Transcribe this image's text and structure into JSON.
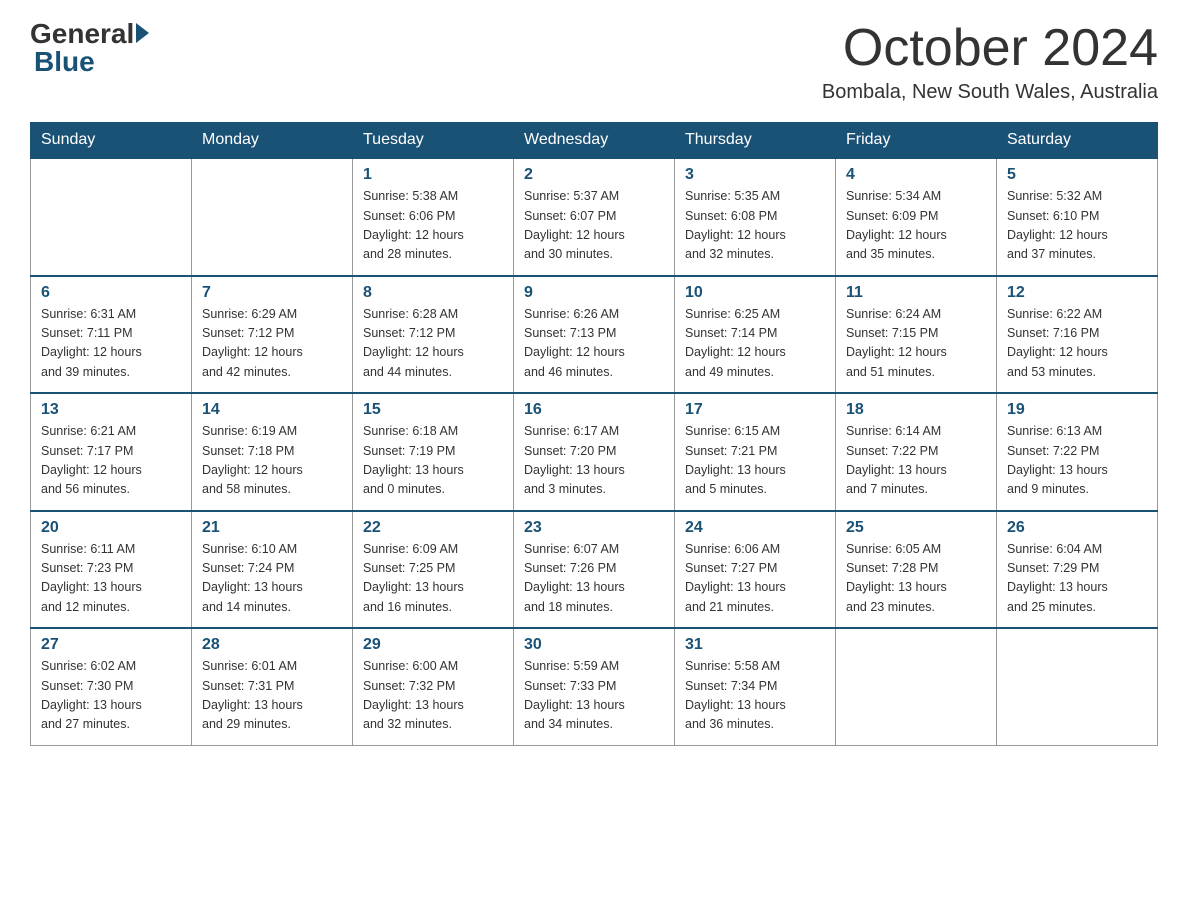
{
  "header": {
    "logo_general": "General",
    "logo_blue": "Blue",
    "month_title": "October 2024",
    "location": "Bombala, New South Wales, Australia"
  },
  "weekdays": [
    "Sunday",
    "Monday",
    "Tuesday",
    "Wednesday",
    "Thursday",
    "Friday",
    "Saturday"
  ],
  "weeks": [
    [
      {
        "day": "",
        "info": ""
      },
      {
        "day": "",
        "info": ""
      },
      {
        "day": "1",
        "info": "Sunrise: 5:38 AM\nSunset: 6:06 PM\nDaylight: 12 hours\nand 28 minutes."
      },
      {
        "day": "2",
        "info": "Sunrise: 5:37 AM\nSunset: 6:07 PM\nDaylight: 12 hours\nand 30 minutes."
      },
      {
        "day": "3",
        "info": "Sunrise: 5:35 AM\nSunset: 6:08 PM\nDaylight: 12 hours\nand 32 minutes."
      },
      {
        "day": "4",
        "info": "Sunrise: 5:34 AM\nSunset: 6:09 PM\nDaylight: 12 hours\nand 35 minutes."
      },
      {
        "day": "5",
        "info": "Sunrise: 5:32 AM\nSunset: 6:10 PM\nDaylight: 12 hours\nand 37 minutes."
      }
    ],
    [
      {
        "day": "6",
        "info": "Sunrise: 6:31 AM\nSunset: 7:11 PM\nDaylight: 12 hours\nand 39 minutes."
      },
      {
        "day": "7",
        "info": "Sunrise: 6:29 AM\nSunset: 7:12 PM\nDaylight: 12 hours\nand 42 minutes."
      },
      {
        "day": "8",
        "info": "Sunrise: 6:28 AM\nSunset: 7:12 PM\nDaylight: 12 hours\nand 44 minutes."
      },
      {
        "day": "9",
        "info": "Sunrise: 6:26 AM\nSunset: 7:13 PM\nDaylight: 12 hours\nand 46 minutes."
      },
      {
        "day": "10",
        "info": "Sunrise: 6:25 AM\nSunset: 7:14 PM\nDaylight: 12 hours\nand 49 minutes."
      },
      {
        "day": "11",
        "info": "Sunrise: 6:24 AM\nSunset: 7:15 PM\nDaylight: 12 hours\nand 51 minutes."
      },
      {
        "day": "12",
        "info": "Sunrise: 6:22 AM\nSunset: 7:16 PM\nDaylight: 12 hours\nand 53 minutes."
      }
    ],
    [
      {
        "day": "13",
        "info": "Sunrise: 6:21 AM\nSunset: 7:17 PM\nDaylight: 12 hours\nand 56 minutes."
      },
      {
        "day": "14",
        "info": "Sunrise: 6:19 AM\nSunset: 7:18 PM\nDaylight: 12 hours\nand 58 minutes."
      },
      {
        "day": "15",
        "info": "Sunrise: 6:18 AM\nSunset: 7:19 PM\nDaylight: 13 hours\nand 0 minutes."
      },
      {
        "day": "16",
        "info": "Sunrise: 6:17 AM\nSunset: 7:20 PM\nDaylight: 13 hours\nand 3 minutes."
      },
      {
        "day": "17",
        "info": "Sunrise: 6:15 AM\nSunset: 7:21 PM\nDaylight: 13 hours\nand 5 minutes."
      },
      {
        "day": "18",
        "info": "Sunrise: 6:14 AM\nSunset: 7:22 PM\nDaylight: 13 hours\nand 7 minutes."
      },
      {
        "day": "19",
        "info": "Sunrise: 6:13 AM\nSunset: 7:22 PM\nDaylight: 13 hours\nand 9 minutes."
      }
    ],
    [
      {
        "day": "20",
        "info": "Sunrise: 6:11 AM\nSunset: 7:23 PM\nDaylight: 13 hours\nand 12 minutes."
      },
      {
        "day": "21",
        "info": "Sunrise: 6:10 AM\nSunset: 7:24 PM\nDaylight: 13 hours\nand 14 minutes."
      },
      {
        "day": "22",
        "info": "Sunrise: 6:09 AM\nSunset: 7:25 PM\nDaylight: 13 hours\nand 16 minutes."
      },
      {
        "day": "23",
        "info": "Sunrise: 6:07 AM\nSunset: 7:26 PM\nDaylight: 13 hours\nand 18 minutes."
      },
      {
        "day": "24",
        "info": "Sunrise: 6:06 AM\nSunset: 7:27 PM\nDaylight: 13 hours\nand 21 minutes."
      },
      {
        "day": "25",
        "info": "Sunrise: 6:05 AM\nSunset: 7:28 PM\nDaylight: 13 hours\nand 23 minutes."
      },
      {
        "day": "26",
        "info": "Sunrise: 6:04 AM\nSunset: 7:29 PM\nDaylight: 13 hours\nand 25 minutes."
      }
    ],
    [
      {
        "day": "27",
        "info": "Sunrise: 6:02 AM\nSunset: 7:30 PM\nDaylight: 13 hours\nand 27 minutes."
      },
      {
        "day": "28",
        "info": "Sunrise: 6:01 AM\nSunset: 7:31 PM\nDaylight: 13 hours\nand 29 minutes."
      },
      {
        "day": "29",
        "info": "Sunrise: 6:00 AM\nSunset: 7:32 PM\nDaylight: 13 hours\nand 32 minutes."
      },
      {
        "day": "30",
        "info": "Sunrise: 5:59 AM\nSunset: 7:33 PM\nDaylight: 13 hours\nand 34 minutes."
      },
      {
        "day": "31",
        "info": "Sunrise: 5:58 AM\nSunset: 7:34 PM\nDaylight: 13 hours\nand 36 minutes."
      },
      {
        "day": "",
        "info": ""
      },
      {
        "day": "",
        "info": ""
      }
    ]
  ]
}
